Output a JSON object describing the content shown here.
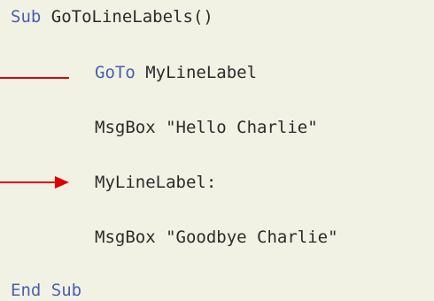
{
  "code": {
    "line1": {
      "keyword": "Sub",
      "rest": " GoToLineLabels()"
    },
    "line2": {
      "keyword": "GoTo",
      "rest": " MyLineLabel"
    },
    "line3": {
      "text": "MsgBox \"Hello Charlie\""
    },
    "line4": {
      "text": "MyLineLabel:"
    },
    "line5": {
      "text": "MsgBox \"Goodbye Charlie\""
    },
    "line6": {
      "keyword": "End Sub"
    }
  },
  "colors": {
    "background": "#f2f2e4",
    "keyword": "#4a5fb0",
    "text": "#2b2b2b",
    "arrow": "#e00000"
  }
}
